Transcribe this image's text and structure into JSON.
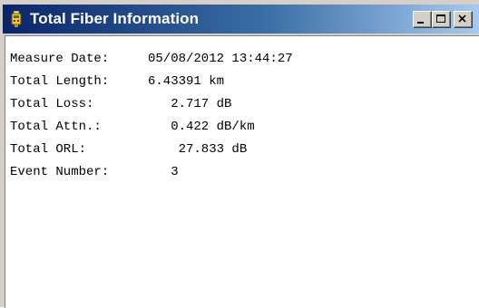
{
  "window": {
    "title": "Total Fiber Information",
    "title_icon": "fiber-device-icon",
    "controls": [
      "minimize-icon",
      "maximize-icon",
      "close-icon"
    ]
  },
  "info": {
    "measure_date": {
      "label": "Measure Date:",
      "value": "05/08/2012 13:44:27"
    },
    "total_length": {
      "label": "Total Length:",
      "value": "6.43391 km"
    },
    "total_loss": {
      "label": "Total Loss:",
      "value": "   2.717 dB"
    },
    "total_attn": {
      "label": "Total Attn.:",
      "value": "   0.422 dB/km"
    },
    "total_orl": {
      "label": "Total ORL:",
      "value": "    27.833 dB"
    },
    "event_number": {
      "label": "Event Number:",
      "value": "   3"
    }
  },
  "colors": {
    "titlebar_start": "#0a246a",
    "titlebar_end": "#a6caf0",
    "window_face": "#d4d0c8"
  }
}
